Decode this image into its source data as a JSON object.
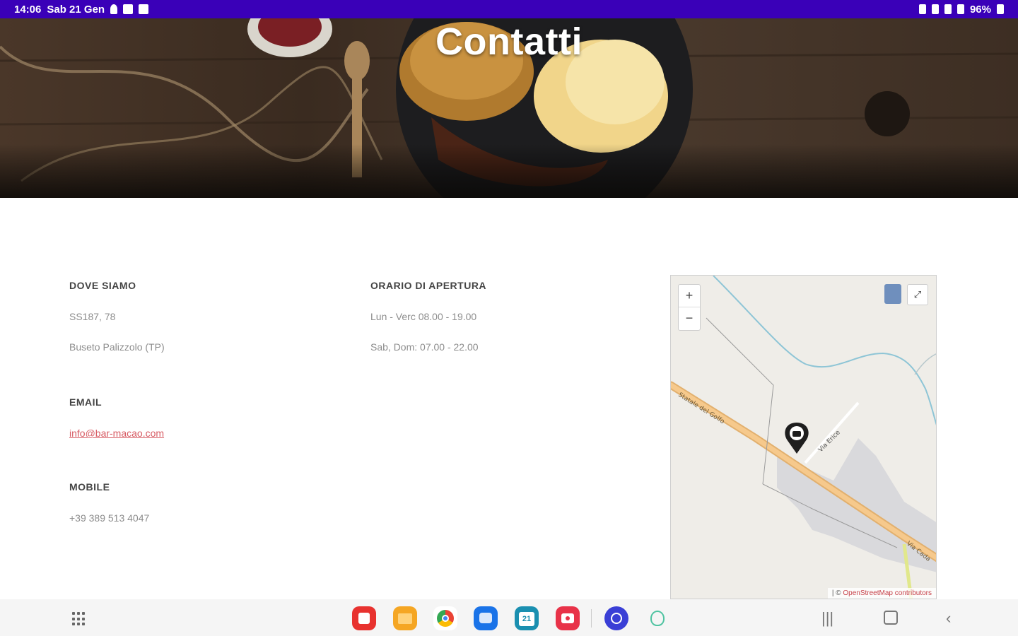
{
  "status_bar": {
    "time": "14:06",
    "date": "Sab 21 Gen",
    "battery": "96%"
  },
  "hero": {
    "title": "Contatti"
  },
  "location": {
    "heading": "DOVE SIAMO",
    "line1": "SS187, 78",
    "line2": "Buseto Palizzolo (TP)"
  },
  "email": {
    "heading": "EMAIL",
    "address": "info@bar-macao.com"
  },
  "mobile": {
    "heading": "MOBILE",
    "number": "+39 389 513 4047"
  },
  "hours": {
    "heading": "ORARIO DI APERTURA",
    "weekdays": "Lun - Verc 08.00 - 19.00",
    "weekend": "Sab, Dom: 07.00 - 22.00"
  },
  "map": {
    "zoom_in": "+",
    "zoom_out": "−",
    "road_label_1": "Statale del Golfo",
    "road_label_2": "Via Erice",
    "road_label_3": "Via Cada",
    "attribution_prefix": "| © ",
    "attribution_link": "OpenStreetMap contributors"
  },
  "taskbar": {
    "apps": [
      {
        "name": "flipboard-icon",
        "color": "#e8322f"
      },
      {
        "name": "files-icon",
        "color": "#f5a623"
      },
      {
        "name": "chrome-icon",
        "color": "#ffffff"
      },
      {
        "name": "messages-icon",
        "color": "#1a73e8"
      },
      {
        "name": "calendar-icon",
        "color": "#1a8fb0"
      },
      {
        "name": "screen-recorder-icon",
        "color": "#e83248"
      },
      {
        "name": "tasks-icon",
        "color": "#3a3fd6"
      },
      {
        "name": "galaxy-store-icon",
        "color": "#4fc3a1"
      }
    ],
    "calendar_day": "21"
  }
}
